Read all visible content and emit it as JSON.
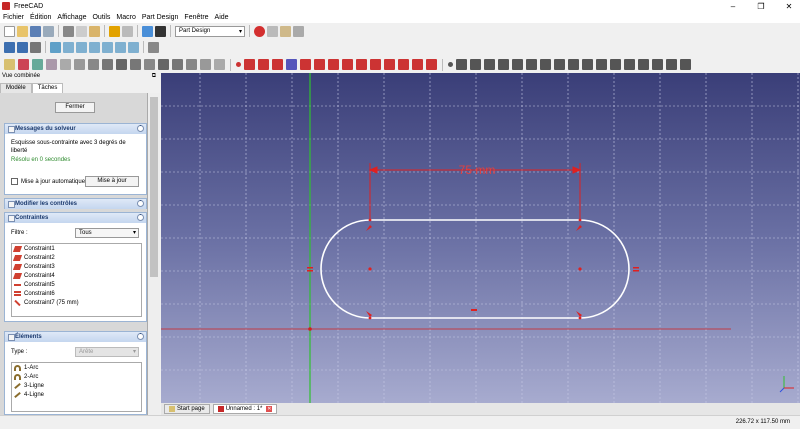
{
  "window": {
    "title": "FreeCAD"
  },
  "menu": [
    "Fichier",
    "Édition",
    "Affichage",
    "Outils",
    "Macro",
    "Part Design",
    "Fenêtre",
    "Aide"
  ],
  "toolbar": {
    "workbench": "Part Design"
  },
  "combo": {
    "title": "Vue combinée",
    "tabs": [
      "Modèle",
      "Tâches"
    ]
  },
  "task": {
    "close_label": "Fermer",
    "solver": {
      "title": "Messages du solveur",
      "message": "Esquisse sous-contrainte avec 3 degrés de liberté",
      "solved": "Résolu en 0 secondes",
      "auto_update_label": "Mise à jour automatique",
      "update_button": "Mise à jour"
    },
    "edit_controls": {
      "title": "Modifier les contrôles"
    },
    "constraints": {
      "title": "Contraintes",
      "filter_label": "Filtre :",
      "filter_value": "Tous",
      "items": [
        "Constraint1",
        "Constraint2",
        "Constraint3",
        "Constraint4",
        "Constraint5",
        "Constraint6",
        "Constraint7 (75 mm)"
      ]
    },
    "elements": {
      "title": "Éléments",
      "type_label": "Type :",
      "type_value": "Arête",
      "items": [
        "1-Arc",
        "2-Arc",
        "3-Ligne",
        "4-Ligne"
      ]
    }
  },
  "canvas": {
    "dimension_label": "75 mm",
    "colors": {
      "geometry": "#ffffff",
      "constraint": "#e02020",
      "axis_v": "#30c030",
      "axis_h": "#d02020"
    }
  },
  "doc_tabs": [
    {
      "label": "Start page",
      "active": false
    },
    {
      "label": "Unnamed : 1*",
      "active": true
    }
  ],
  "status": {
    "coords": "226.72 x 117.50 mm"
  }
}
